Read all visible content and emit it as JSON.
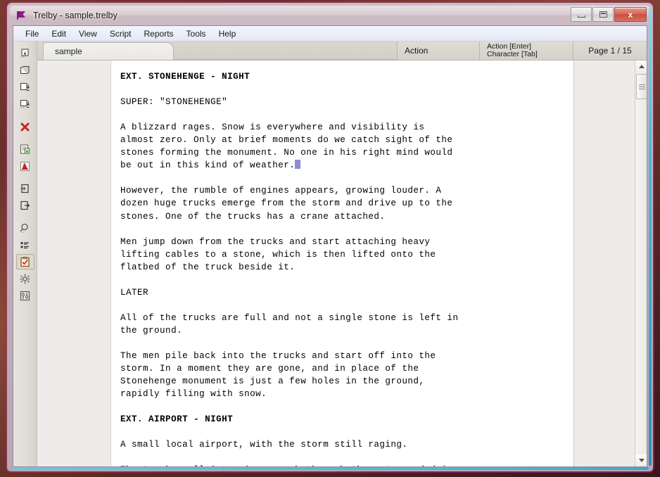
{
  "window": {
    "title": "Trelby - sample.trelby",
    "app_icon": "flag-icon",
    "minimize_label": "Minimize",
    "maximize_label": "Maximize",
    "close_label": "x"
  },
  "menubar": {
    "items": [
      {
        "label": "File"
      },
      {
        "label": "Edit"
      },
      {
        "label": "View"
      },
      {
        "label": "Script"
      },
      {
        "label": "Reports"
      },
      {
        "label": "Tools"
      },
      {
        "label": "Help"
      }
    ]
  },
  "toolbar": {
    "items": [
      {
        "icon": "new-script-icon",
        "tooltip": "New"
      },
      {
        "icon": "open-script-icon",
        "tooltip": "Open"
      },
      {
        "icon": "save-script-icon",
        "tooltip": "Save"
      },
      {
        "icon": "save-as-icon",
        "tooltip": "Save As"
      },
      {
        "icon": "close-script-icon",
        "tooltip": "Close"
      },
      {
        "icon": "print-preview-icon",
        "tooltip": "Print preview"
      },
      {
        "icon": "export-pdf-icon",
        "tooltip": "Export to PDF"
      },
      {
        "icon": "import-icon",
        "tooltip": "Import"
      },
      {
        "icon": "export-icon",
        "tooltip": "Export"
      },
      {
        "icon": "find-icon",
        "tooltip": "Find & Replace"
      },
      {
        "icon": "scene-list-icon",
        "tooltip": "Scene list"
      },
      {
        "icon": "spell-check-icon",
        "tooltip": "Spell check"
      },
      {
        "icon": "settings-gear-icon",
        "tooltip": "Settings"
      },
      {
        "icon": "compare-scripts-icon",
        "tooltip": "Compare scripts"
      }
    ]
  },
  "tabs": [
    {
      "label": "sample",
      "active": true
    }
  ],
  "status": {
    "element_type": "Action",
    "key_enter": "Action [Enter]",
    "key_tab": "Character [Tab]",
    "page": "Page 1 / 15"
  },
  "script": {
    "lines": [
      {
        "text": "EXT. STONEHENGE - NIGHT",
        "style": "bold"
      },
      {
        "text": "",
        "style": "blank"
      },
      {
        "text": "SUPER: \"STONEHENGE\"",
        "style": "action"
      },
      {
        "text": "",
        "style": "blank"
      },
      {
        "text": "A blizzard rages. Snow is everywhere and visibility is",
        "style": "action"
      },
      {
        "text": "almost zero. Only at brief moments do we catch sight of the",
        "style": "action"
      },
      {
        "text": "stones forming the monument. No one in his right mind would",
        "style": "action"
      },
      {
        "text": "be out in this kind of weather.",
        "style": "action-caret"
      },
      {
        "text": "",
        "style": "blank"
      },
      {
        "text": "However, the rumble of engines appears, growing louder. A",
        "style": "action"
      },
      {
        "text": "dozen huge trucks emerge from the storm and drive up to the",
        "style": "action"
      },
      {
        "text": "stones. One of the trucks has a crane attached.",
        "style": "action"
      },
      {
        "text": "",
        "style": "blank"
      },
      {
        "text": "Men jump down from the trucks and start attaching heavy",
        "style": "action"
      },
      {
        "text": "lifting cables to a stone, which is then lifted onto the",
        "style": "action"
      },
      {
        "text": "flatbed of the truck beside it.",
        "style": "action"
      },
      {
        "text": "",
        "style": "blank"
      },
      {
        "text": "LATER",
        "style": "action"
      },
      {
        "text": "",
        "style": "blank"
      },
      {
        "text": "All of the trucks are full and not a single stone is left in",
        "style": "action"
      },
      {
        "text": "the ground.",
        "style": "action"
      },
      {
        "text": "",
        "style": "blank"
      },
      {
        "text": "The men pile back into the trucks and start off into the",
        "style": "action"
      },
      {
        "text": "storm. In a moment they are gone, and in place of the",
        "style": "action"
      },
      {
        "text": "Stonehenge monument is just a few holes in the ground,",
        "style": "action"
      },
      {
        "text": "rapidly filling with snow.",
        "style": "action"
      },
      {
        "text": "",
        "style": "blank"
      },
      {
        "text": "EXT. AIRPORT - NIGHT",
        "style": "bold"
      },
      {
        "text": "",
        "style": "blank"
      },
      {
        "text": "A small local airport, with the storm still raging.",
        "style": "action"
      },
      {
        "text": "",
        "style": "blank"
      },
      {
        "text": "The trucks roll into view, smash through the gates and drive",
        "style": "action"
      }
    ]
  },
  "scrollbar": {
    "up_arrow": "scroll-up-arrow",
    "down_arrow": "scroll-down-arrow",
    "thumb": "scroll-thumb"
  },
  "colors": {
    "caret": "#8b8bd8",
    "page_background": "#ffffff",
    "window_border": "#a03c6e",
    "glow": "#4fb7d8",
    "close_button": "#c8503f"
  }
}
